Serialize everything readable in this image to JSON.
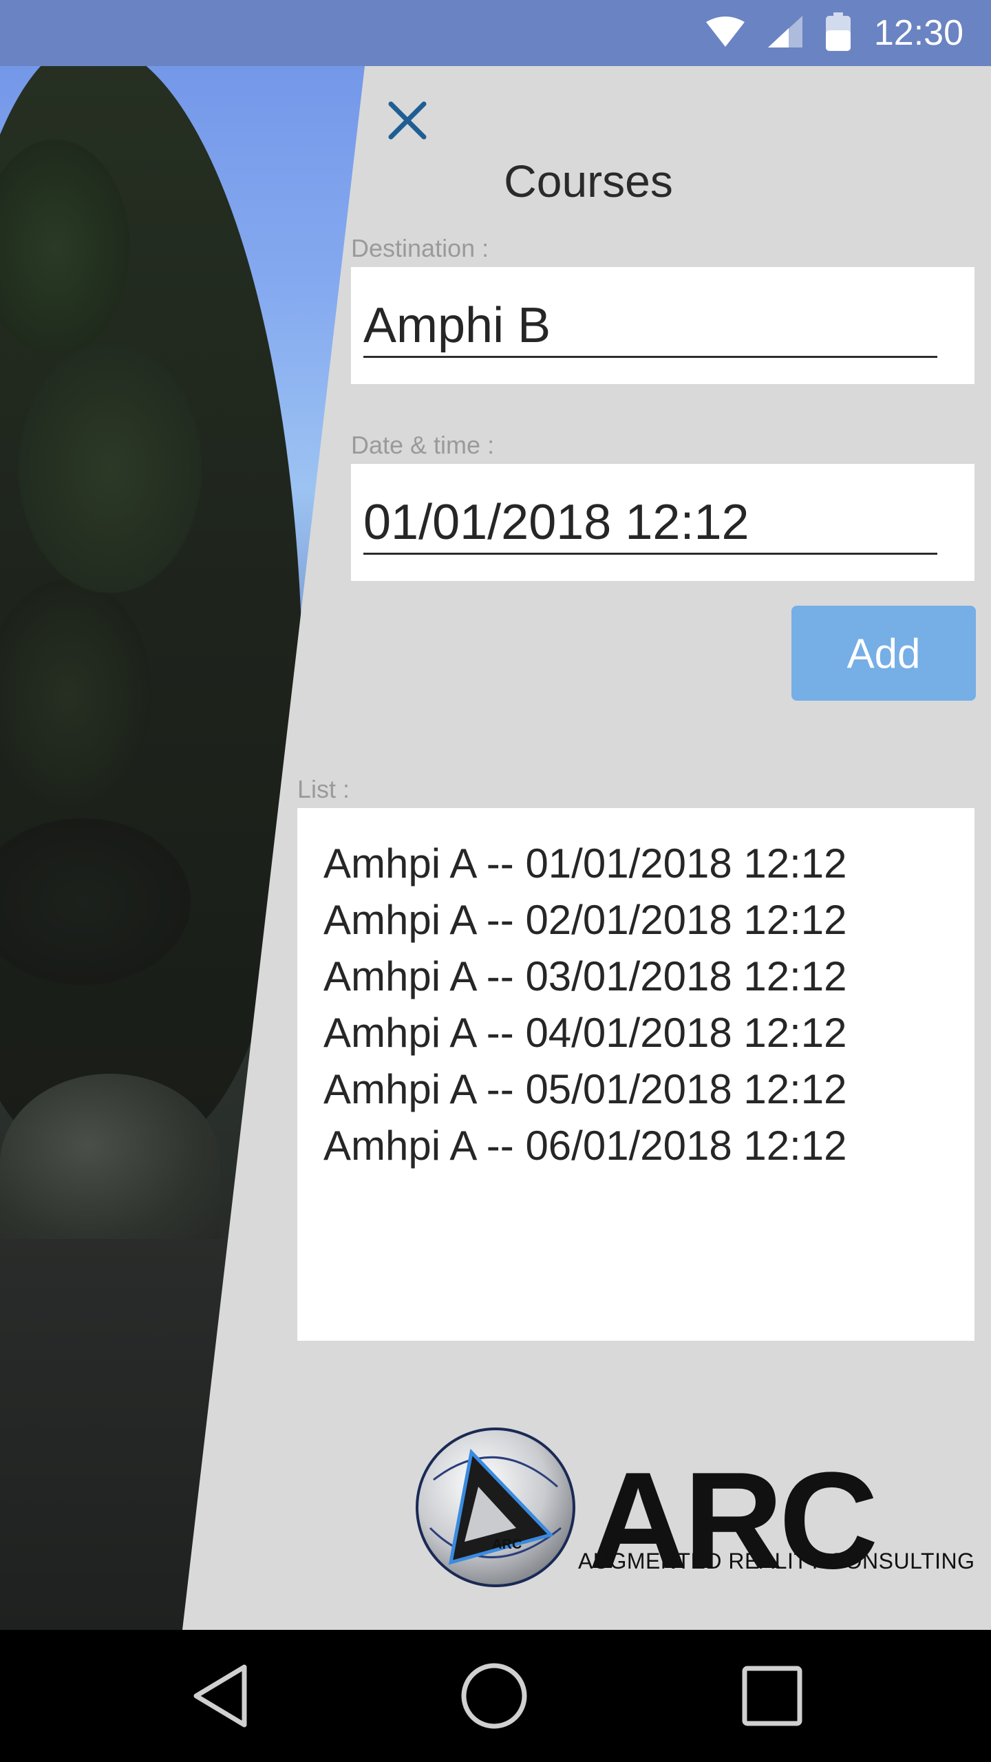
{
  "status_bar": {
    "time": "12:30",
    "icons": [
      "wifi-icon",
      "signal-icon",
      "battery-icon"
    ]
  },
  "header": {
    "close_icon": "close-icon",
    "title": "Courses"
  },
  "form": {
    "destination": {
      "label": "Destination :",
      "value": "Amphi B"
    },
    "datetime": {
      "label": "Date & time :",
      "value": "01/01/2018 12:12"
    },
    "add_label": "Add"
  },
  "list": {
    "label": "List :",
    "items": [
      "Amhpi A -- 01/01/2018 12:12",
      "Amhpi A -- 02/01/2018 12:12",
      "Amhpi A -- 03/01/2018 12:12",
      "Amhpi A -- 04/01/2018 12:12",
      "Amhpi A -- 05/01/2018 12:12",
      "Amhpi A -- 06/01/2018 12:12"
    ]
  },
  "logo": {
    "name": "ARC",
    "mark_text": "ARC",
    "subtitle": "AUGMENTED REALITY CONSULTING"
  },
  "nav_bar": {
    "icons": [
      "back-icon",
      "home-icon",
      "recents-icon"
    ]
  },
  "colors": {
    "accent_button": "#76aee6",
    "status_bar": "#6a83c2",
    "panel": "#d9d9d9",
    "close_icon": "#1f5e94"
  }
}
